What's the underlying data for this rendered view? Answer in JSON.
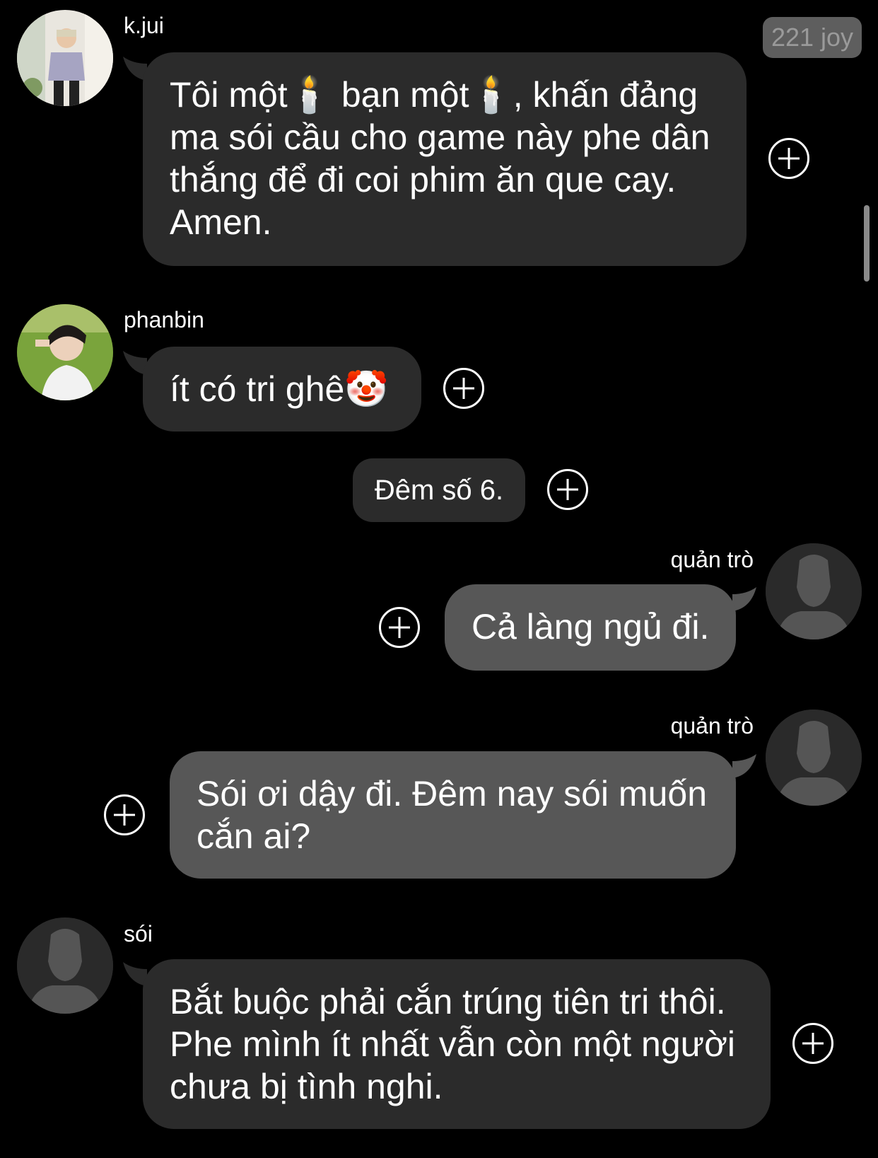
{
  "header": {
    "badge": "221 joy"
  },
  "messages": [
    {
      "sender": "k.jui",
      "lines": [
        "Tôi một🕯️ bạn một🕯️, khấn đảng",
        "ma sói cầu cho game này phe dân",
        "thắng để đi coi phim ăn que cay.",
        "Amen."
      ]
    },
    {
      "sender": "phanbin",
      "lines": [
        "ít có tri ghê🤡"
      ]
    },
    {
      "system": "Đêm số 6."
    },
    {
      "sender": "quản trò",
      "lines": [
        "Cả làng ngủ đi."
      ]
    },
    {
      "sender": "quản trò",
      "lines": [
        "Sói ơi dậy đi. Đêm nay sói muốn",
        "cắn ai?"
      ]
    },
    {
      "sender": "sói",
      "lines": [
        "Bắt buộc phải cắn trúng tiên tri thôi.",
        "Phe mình ít nhất vẫn còn một người",
        "chưa bị tình nghi."
      ]
    }
  ],
  "colors": {
    "background": "#000000",
    "incoming_bubble": "#2b2b2b",
    "outgoing_bubble": "#575757",
    "badge_bg": "#5e5e5e",
    "badge_text": "#9a9a9a"
  },
  "icons": [
    "add-reaction-icon",
    "default-avatar-icon",
    "candle-emoji",
    "clown-emoji"
  ]
}
